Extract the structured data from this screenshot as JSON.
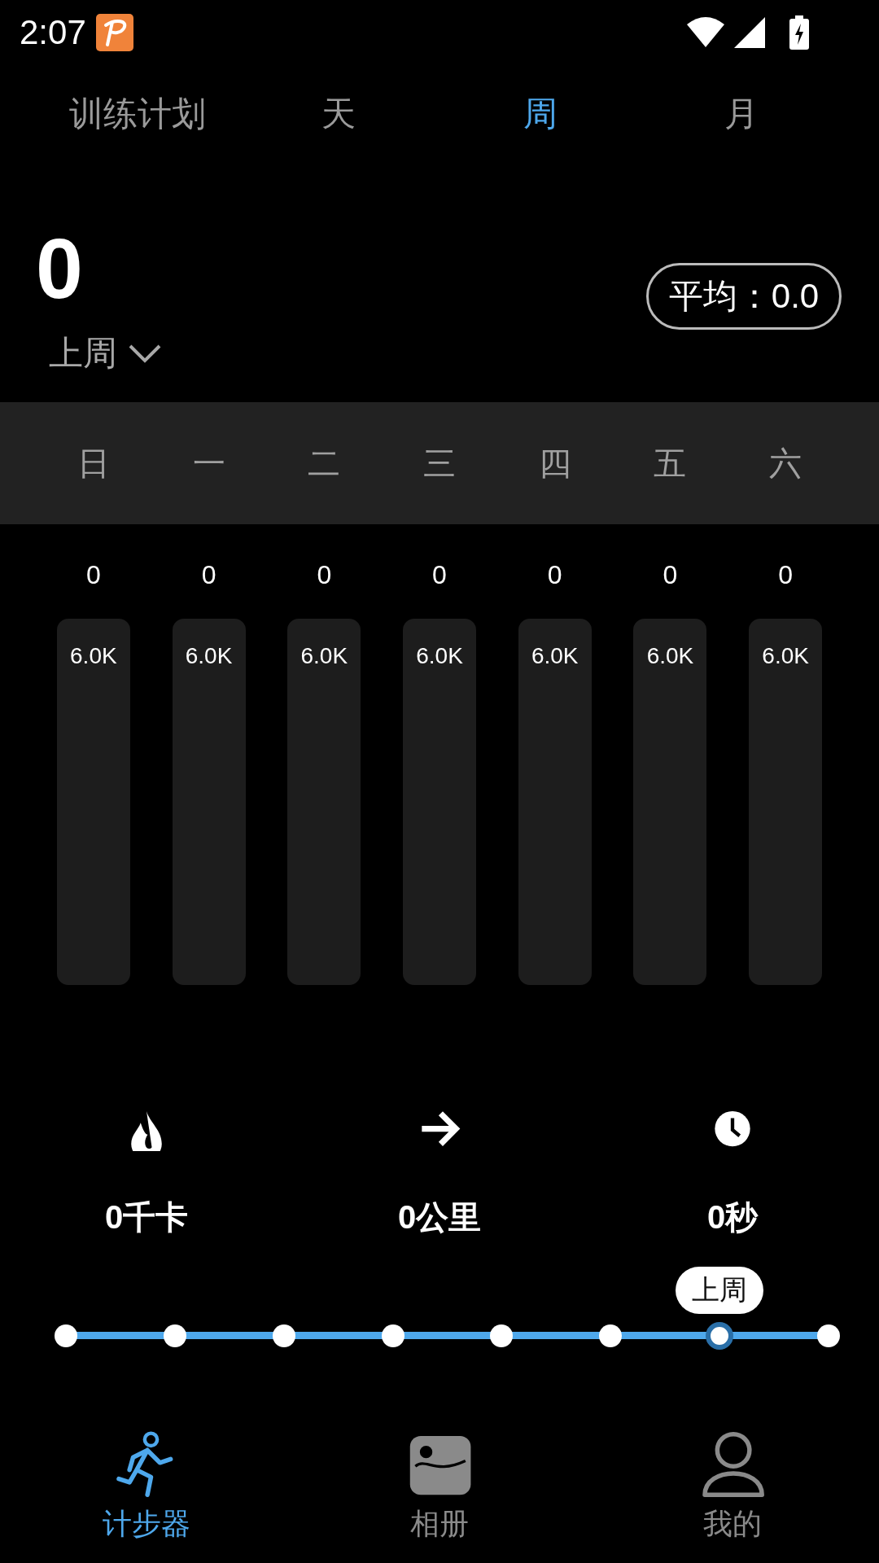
{
  "status_bar": {
    "time": "2:07"
  },
  "tabs": [
    {
      "label": "训练计划",
      "selected": false
    },
    {
      "label": "天",
      "selected": false
    },
    {
      "label": "周",
      "selected": true
    },
    {
      "label": "月",
      "selected": false
    }
  ],
  "summary": {
    "total": "0",
    "period": "上周",
    "average": "平均：0.0"
  },
  "weekdays": [
    "日",
    "一",
    "二",
    "三",
    "四",
    "五",
    "六"
  ],
  "bars": [
    {
      "value": "0",
      "goal": "6.0K"
    },
    {
      "value": "0",
      "goal": "6.0K"
    },
    {
      "value": "0",
      "goal": "6.0K"
    },
    {
      "value": "0",
      "goal": "6.0K"
    },
    {
      "value": "0",
      "goal": "6.0K"
    },
    {
      "value": "0",
      "goal": "6.0K"
    },
    {
      "value": "0",
      "goal": "6.0K"
    }
  ],
  "stats": [
    {
      "kind": "calories",
      "value": "0千卡"
    },
    {
      "kind": "distance",
      "value": "0公里"
    },
    {
      "kind": "duration",
      "value": "0秒"
    }
  ],
  "timeline": {
    "label": "上周",
    "points": [
      {
        "selected": false
      },
      {
        "selected": false
      },
      {
        "selected": false
      },
      {
        "selected": false
      },
      {
        "selected": false
      },
      {
        "selected": false
      },
      {
        "selected": true
      },
      {
        "selected": false
      }
    ]
  },
  "bottom_nav": [
    {
      "kind": "run",
      "label": "计步器",
      "selected": true
    },
    {
      "kind": "album",
      "label": "相册",
      "selected": false
    },
    {
      "kind": "profile",
      "label": "我的",
      "selected": false
    }
  ]
}
